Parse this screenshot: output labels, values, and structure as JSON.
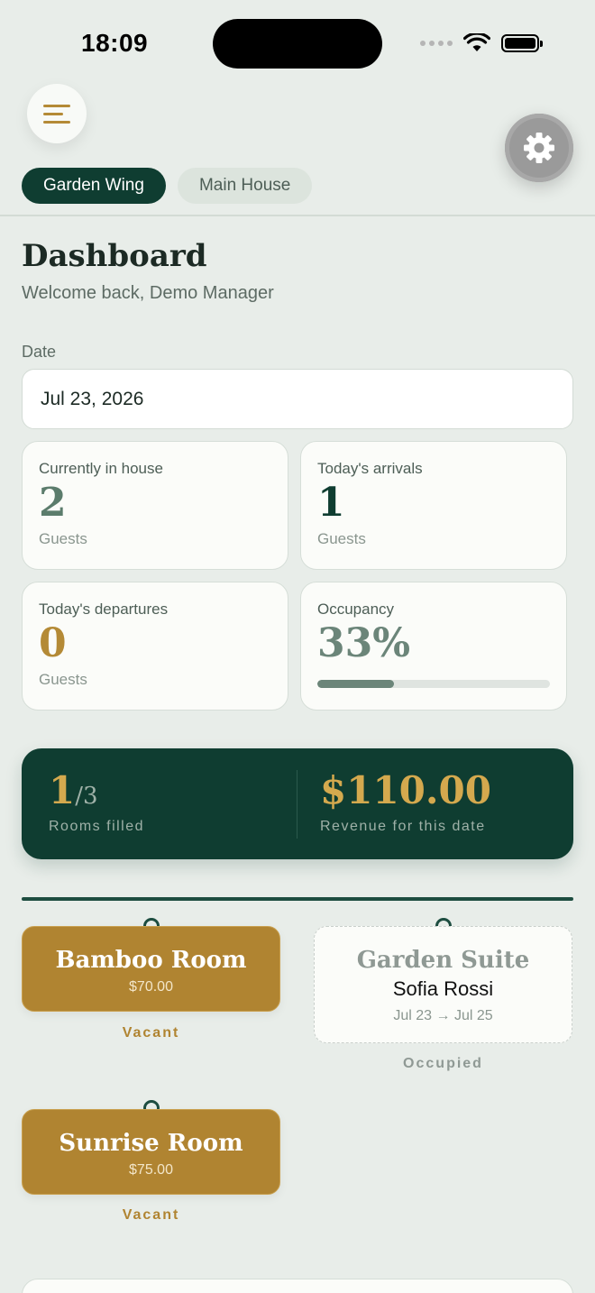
{
  "status_bar": {
    "time": "18:09"
  },
  "header": {
    "wings": [
      {
        "label": "Garden Wing",
        "active": true
      },
      {
        "label": "Main House",
        "active": false
      }
    ]
  },
  "dashboard": {
    "title": "Dashboard",
    "welcome": "Welcome back, Demo Manager",
    "date_label": "Date",
    "date_value": "Jul 23, 2026"
  },
  "stats": {
    "in_house": {
      "label": "Currently in house",
      "value": "2",
      "sub": "Guests"
    },
    "arrivals": {
      "label": "Today's arrivals",
      "value": "1",
      "sub": "Guests"
    },
    "departures": {
      "label": "Today's departures",
      "value": "0",
      "sub": "Guests"
    },
    "occupancy": {
      "label": "Occupancy",
      "value": "33%",
      "progress_percent": 33
    }
  },
  "summary": {
    "rooms_filled": "1",
    "rooms_total": "/3",
    "rooms_caption": "Rooms filled",
    "revenue": "$110.00",
    "revenue_caption": "Revenue for this date"
  },
  "rooms": [
    {
      "name": "Bamboo Room",
      "price": "$70.00",
      "status": "Vacant"
    },
    {
      "name": "Garden Suite",
      "guest": "Sofia Rossi",
      "dates": "Jul 23 → Jul 25",
      "status": "Occupied"
    },
    {
      "name": "Sunrise Room",
      "price": "$75.00",
      "status": "Vacant"
    }
  ],
  "colors": {
    "primary": "#0f3d31",
    "accent_gold": "#b08431",
    "background": "#e8ede9"
  },
  "icons": [
    "menu-icon",
    "gear-icon",
    "wifi-icon",
    "battery-icon",
    "signal-icon"
  ]
}
